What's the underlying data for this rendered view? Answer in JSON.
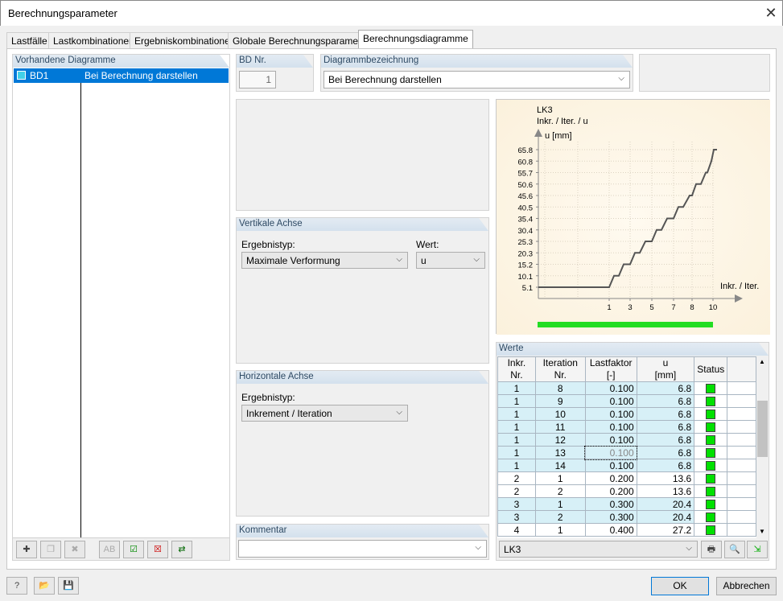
{
  "window": {
    "title": "Berechnungsparameter"
  },
  "tabs": [
    "Lastfälle",
    "Lastkombinationen",
    "Ergebniskombinationen",
    "Globale Berechnungsparameter",
    "Berechnungsdiagramme"
  ],
  "left": {
    "header": "Vorhandene Diagramme",
    "items": [
      {
        "id": "BD1",
        "name": "Bei Berechnung darstellen"
      }
    ]
  },
  "bd": {
    "header": "BD Nr.",
    "value": "1"
  },
  "diag": {
    "header": "Diagrammbezeichnung",
    "value": "Bei Berechnung darstellen"
  },
  "vertical": {
    "header": "Vertikale Achse",
    "type_label": "Ergebnistyp:",
    "type_value": "Maximale Verformung",
    "val_label": "Wert:",
    "val_value": "u"
  },
  "horizontal": {
    "header": "Horizontale Achse",
    "type_label": "Ergebnistyp:",
    "type_value": "Inkrement / Iteration"
  },
  "comment": {
    "header": "Kommentar",
    "value": ""
  },
  "chart_data": {
    "type": "line",
    "title": "LK3",
    "subtitle": "Inkr. / Iter. / u",
    "ylabel": "u [mm]",
    "xlabel": "Inkr. / Iter.",
    "yticks": [
      "65.8",
      "60.8",
      "55.7",
      "50.6",
      "45.6",
      "40.5",
      "35.4",
      "30.4",
      "25.3",
      "20.3",
      "15.2",
      "10.1",
      "5.1"
    ],
    "xticks": [
      "1",
      "3",
      "5",
      "7",
      "8",
      "10"
    ],
    "progress": 1.0
  },
  "values": {
    "header": "Werte",
    "columns": [
      [
        "Inkr.",
        "Nr."
      ],
      [
        "Iteration",
        "Nr."
      ],
      [
        "Lastfaktor",
        "[-]"
      ],
      [
        "u",
        "[mm]"
      ],
      [
        "",
        "Status"
      ]
    ],
    "rows": [
      [
        "1",
        "8",
        "0.100",
        "6.8"
      ],
      [
        "1",
        "9",
        "0.100",
        "6.8"
      ],
      [
        "1",
        "10",
        "0.100",
        "6.8"
      ],
      [
        "1",
        "11",
        "0.100",
        "6.8"
      ],
      [
        "1",
        "12",
        "0.100",
        "6.8"
      ],
      [
        "1",
        "13",
        "0.100",
        "6.8"
      ],
      [
        "1",
        "14",
        "0.100",
        "6.8"
      ],
      [
        "2",
        "1",
        "0.200",
        "13.6"
      ],
      [
        "2",
        "2",
        "0.200",
        "13.6"
      ],
      [
        "3",
        "1",
        "0.300",
        "20.4"
      ],
      [
        "3",
        "2",
        "0.300",
        "20.4"
      ],
      [
        "4",
        "1",
        "0.400",
        "27.2"
      ]
    ],
    "lc": "LK3"
  },
  "buttons": {
    "ok": "OK",
    "cancel": "Abbrechen"
  }
}
